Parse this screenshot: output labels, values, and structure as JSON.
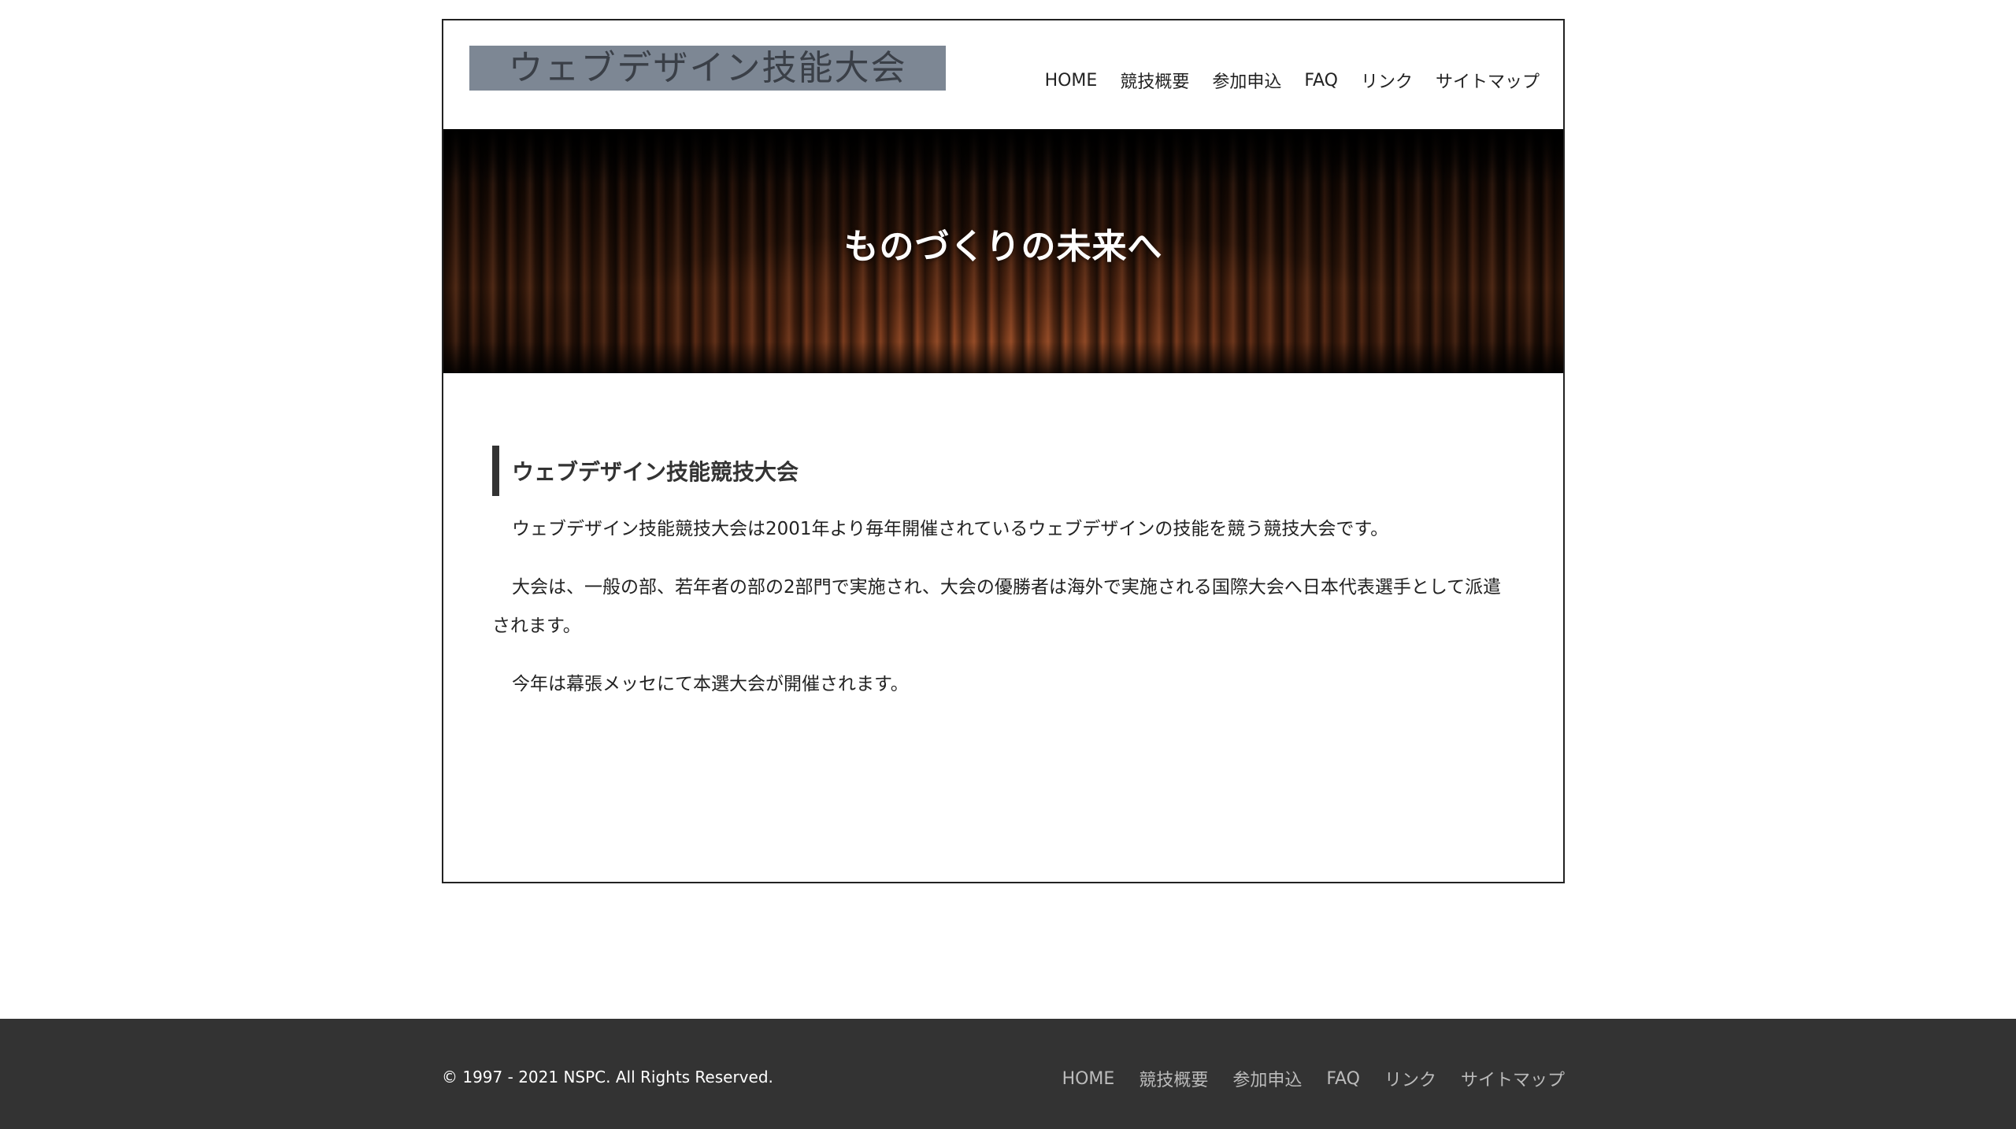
{
  "header": {
    "logo_text": "ウェブデザイン技能大会",
    "nav": [
      {
        "label": "HOME"
      },
      {
        "label": "競技概要"
      },
      {
        "label": "参加申込"
      },
      {
        "label": "FAQ"
      },
      {
        "label": "リンク"
      },
      {
        "label": "サイトマップ"
      }
    ]
  },
  "hero": {
    "tagline": "ものづくりの未来へ"
  },
  "main": {
    "heading": "ウェブデザイン技能競技大会",
    "paragraphs": [
      "ウェブデザイン技能競技大会は2001年より毎年開催されているウェブデザインの技能を競う競技大会です。",
      "大会は、一般の部、若年者の部の2部門で実施され、大会の優勝者は海外で実施される国際大会へ日本代表選手として派遣されます。",
      "今年は幕張メッセにて本選大会が開催されます。"
    ]
  },
  "footer": {
    "copyright": "© 1997 - 2021 NSPC. All Rights Reserved.",
    "nav": [
      {
        "label": "HOME"
      },
      {
        "label": "競技概要"
      },
      {
        "label": "参加申込"
      },
      {
        "label": "FAQ"
      },
      {
        "label": "リンク"
      },
      {
        "label": "サイトマップ"
      }
    ]
  },
  "colors": {
    "logo_bg": "#7d8794",
    "footer_bg": "#333333",
    "heading_bar": "#333333"
  }
}
